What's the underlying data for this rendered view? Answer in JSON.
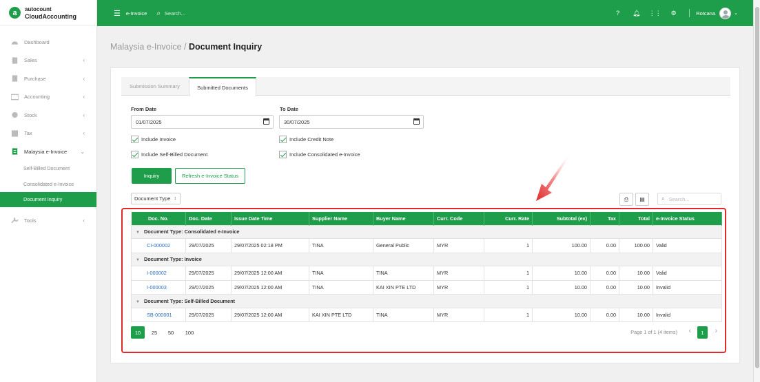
{
  "brand": {
    "top": "autocount",
    "bottom": "CloudAccounting"
  },
  "sidebar": {
    "items": [
      {
        "label": "Dashboard",
        "icon": "dashboard-icon",
        "chevron": false
      },
      {
        "label": "Sales",
        "icon": "sales-icon",
        "chevron": true
      },
      {
        "label": "Purchase",
        "icon": "purchase-icon",
        "chevron": true
      },
      {
        "label": "Accounting",
        "icon": "accounting-icon",
        "chevron": true
      },
      {
        "label": "Stock",
        "icon": "stock-icon",
        "chevron": true
      },
      {
        "label": "Tax",
        "icon": "tax-icon",
        "chevron": true
      },
      {
        "label": "Malaysia e-Invoice",
        "icon": "einvoice-icon",
        "chevron": true,
        "open": true
      },
      {
        "label": "Tools",
        "icon": "tools-icon",
        "chevron": true
      }
    ],
    "sub_items": [
      {
        "label": "Self-Billed Document"
      },
      {
        "label": "Consolidated e-Invoice"
      },
      {
        "label": "Document Inquiry",
        "active": true
      }
    ]
  },
  "topbar": {
    "module": "e-Invoice",
    "search_placeholder": "Search...",
    "user": "Rotcana"
  },
  "breadcrumb": {
    "parent": "Malaysia e-Invoice /",
    "current": "Document Inquiry"
  },
  "tabs": [
    {
      "label": "Submission Summary"
    },
    {
      "label": "Submitted Documents",
      "active": true
    }
  ],
  "filters": {
    "from_label": "From Date",
    "from_value": "01/07/2025",
    "to_label": "To Date",
    "to_value": "30/07/2025",
    "checkboxes": [
      "Include Invoice",
      "Include Credit Note",
      "Include Self-Billed Document",
      "Include Consolidated e-Invoice"
    ]
  },
  "buttons": {
    "inquiry": "Inquiry",
    "refresh": "Refresh e-Invoice Status"
  },
  "grid": {
    "group_chip": "Document Type",
    "search_placeholder": "Search...",
    "columns": [
      "Doc. No.",
      "Doc. Date",
      "Issue Date Time",
      "Supplier Name",
      "Buyer Name",
      "Curr. Code",
      "Curr. Rate",
      "Subtotal (ex)",
      "Tax",
      "Total",
      "e-Invoice Status"
    ],
    "groups": [
      {
        "title": "Document Type: Consolidated e-Invoice",
        "rows": [
          [
            "CI-000002",
            "29/07/2025",
            "29/07/2025 02:18 PM",
            "TINA",
            "General Public",
            "MYR",
            "1",
            "100.00",
            "0.00",
            "100.00",
            "Valid"
          ]
        ]
      },
      {
        "title": "Document Type: Invoice",
        "rows": [
          [
            "I-000002",
            "29/07/2025",
            "29/07/2025 12:00 AM",
            "TINA",
            "TINA",
            "MYR",
            "1",
            "10.00",
            "0.00",
            "10.00",
            "Valid"
          ],
          [
            "I-000003",
            "29/07/2025",
            "29/07/2025 12:00 AM",
            "TINA",
            "KAI XIN PTE LTD",
            "MYR",
            "1",
            "10.00",
            "0.00",
            "10.00",
            "Invalid"
          ]
        ]
      },
      {
        "title": "Document Type: Self-Billed Document",
        "rows": [
          [
            "SB-000001",
            "29/07/2025",
            "29/07/2025 12:00 AM",
            "KAI XIN PTE LTD",
            "TINA",
            "MYR",
            "1",
            "10.00",
            "0.00",
            "10.00",
            "Invalid"
          ]
        ]
      }
    ]
  },
  "pager": {
    "sizes": [
      "10",
      "25",
      "50",
      "100"
    ],
    "info": "Page 1 of 1 (4 items)",
    "current": "1"
  },
  "colors": {
    "accent": "#1e9e4a",
    "highlight": "#e02a2a",
    "link": "#2a6ebb"
  }
}
